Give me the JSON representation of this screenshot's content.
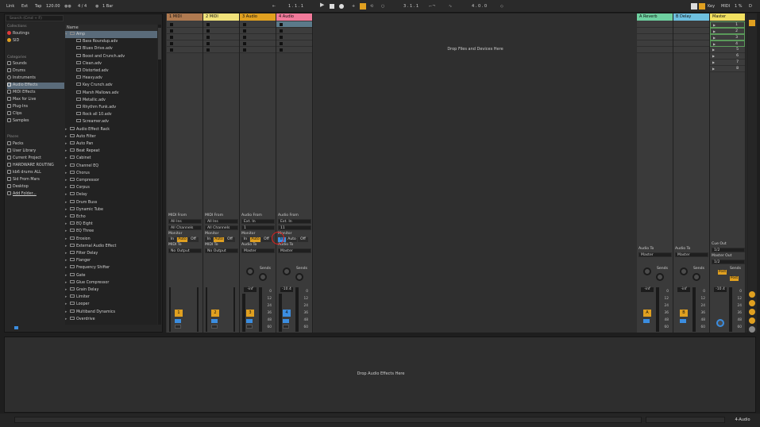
{
  "topbar": {
    "link": "Link",
    "ext": "Ext",
    "tap": "Tap",
    "tempo": "120.00",
    "meter": "4 / 4",
    "quant": "1 Bar",
    "pos1": "1 . 1 . 1",
    "pos2": "3 . 1 . 1",
    "pos3": "4 . 0 . 0",
    "key": "Key",
    "midi": "MIDI",
    "cpu": "1 %",
    "d": "D"
  },
  "browser": {
    "search_placeholder": "Search (Cmd + F)",
    "collections_title": "Collections",
    "collections": [
      {
        "label": "Routings",
        "color": "#e03b3b"
      },
      {
        "label": "SID",
        "color": "#e0a020"
      }
    ],
    "categories_title": "Categories",
    "categories": [
      "Sounds",
      "Drums",
      "Instruments",
      "Audio Effects",
      "MIDI Effects",
      "Max for Live",
      "Plug-Ins",
      "Clips",
      "Samples"
    ],
    "places_title": "Places",
    "places": [
      "Packs",
      "User Library",
      "Current Project",
      "HARDWARE ROUTING",
      "kb6 drums ALL",
      "Sid From Mars",
      "Desktop",
      "Add Folder..."
    ],
    "name_header": "Name",
    "files": [
      "Amp",
      "Bass Roundup.adv",
      "Blues Drive.adv",
      "Boost and Crunch.adv",
      "Clean.adv",
      "Distorted.adv",
      "Heavy.adv",
      "Key Crunch.adv",
      "Marsh Mallows.adv",
      "Metallic.adv",
      "Rhythm Funk.adv",
      "Rock all 10.adv",
      "Screamer.adv",
      "Audio Effect Rack",
      "Auto Filter",
      "Auto Pan",
      "Beat Repeat",
      "Cabinet",
      "Channel EQ",
      "Chorus",
      "Compressor",
      "Corpus",
      "Delay",
      "Drum Buss",
      "Dynamic Tube",
      "Echo",
      "EQ Eight",
      "EQ Three",
      "Erosion",
      "External Audio Effect",
      "Filter Delay",
      "Flanger",
      "Frequency Shifter",
      "Gate",
      "Glue Compressor",
      "Grain Delay",
      "Limiter",
      "Looper",
      "Multiband Dynamics",
      "Overdrive"
    ]
  },
  "tracks": [
    {
      "name": "1 MIDI",
      "color": "#b07a50",
      "num": "1",
      "io_label": "MIDI From",
      "from": "All Ins",
      "chan": "All Channels",
      "monitor": "Monitor",
      "mon": [
        "In",
        "Auto",
        "Off"
      ],
      "to_label": "MIDI To",
      "to": "No Output"
    },
    {
      "name": "2 MIDI",
      "color": "#f1e27a",
      "num": "2",
      "io_label": "MIDI From",
      "from": "All Ins",
      "chan": "All Channels",
      "monitor": "Monitor",
      "mon": [
        "In",
        "Auto",
        "Off"
      ],
      "to_label": "MIDI To",
      "to": "No Output"
    },
    {
      "name": "3 Audio",
      "color": "#e0a020",
      "num": "3",
      "io_label": "Audio From",
      "from": "Ext. In",
      "chan": "1",
      "monitor": "Monitor",
      "mon": [
        "In",
        "Auto",
        "Off"
      ],
      "to_label": "Audio To",
      "to": "Master",
      "vol": "-inf",
      "sends": "Sends"
    },
    {
      "name": "4 Audio",
      "color": "#f17a9a",
      "num": "4",
      "io_label": "Audio From",
      "from": "Ext. In",
      "chan": "11",
      "monitor": "Monitor",
      "mon": [
        "In",
        "Auto",
        "Off"
      ],
      "to_label": "Audio To",
      "to": "Master",
      "vol": "-10.4",
      "sends": "Sends"
    }
  ],
  "drop_files": "Drop Files and Devices Here",
  "returns": [
    {
      "name": "A Reverb",
      "color": "#6ed0a0",
      "num": "A",
      "to_label": "Audio To",
      "to": "Master",
      "vol": "-inf",
      "sends": "Sends"
    },
    {
      "name": "B Delay",
      "color": "#6ec0e0",
      "num": "B",
      "to_label": "Audio To",
      "to": "Master",
      "vol": "-inf",
      "sends": "Sends"
    }
  ],
  "master": {
    "name": "Master",
    "color": "#f1e060",
    "scenes": [
      "1",
      "2",
      "3",
      "4",
      "5",
      "6",
      "7",
      "8"
    ],
    "cue_label": "Cue Out",
    "cue": "1/2",
    "out_label": "Master Out",
    "out": "1/2",
    "vol": "-10.4",
    "sends": "Sends",
    "post": "Post"
  },
  "scale": [
    "0",
    "12",
    "24",
    "36",
    "48",
    "60"
  ],
  "detail_drop": "Drop Audio Effects Here",
  "status_track": "4-Audio"
}
